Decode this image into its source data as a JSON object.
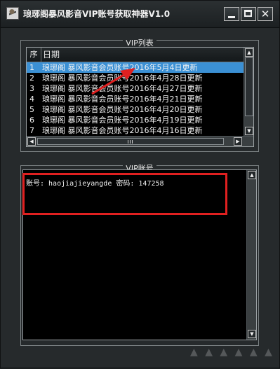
{
  "window": {
    "title": "琅琊阁暴风影音VIP账号获取神器V1.0",
    "controls": {
      "minimize": "minimize",
      "maximize": "maximize",
      "close": "✕"
    }
  },
  "vip_list": {
    "caption": "VIP列表",
    "columns": {
      "seq": "序",
      "date": "日期"
    },
    "rows": [
      {
        "seq": "1",
        "text": "琅琊阁 暴风影音会员账号2016年5月4日更新",
        "selected": true
      },
      {
        "seq": "2",
        "text": "琅琊阁 暴风影音会员账号2016年4月28日更新"
      },
      {
        "seq": "3",
        "text": "琅琊阁 暴风影音会员账号2016年4月27日更新"
      },
      {
        "seq": "4",
        "text": "琅琊阁 暴风影音会员账号2016年4月21日更新"
      },
      {
        "seq": "5",
        "text": "琅琊阁 暴风影音会员账号2016年4月20日更新"
      },
      {
        "seq": "6",
        "text": "琅琊阁 暴风影音会员账号2016年4月19日更新"
      },
      {
        "seq": "7",
        "text": "琅琊阁 暴风影音会员账号2016年4月16日更新"
      }
    ]
  },
  "vip_account": {
    "caption": "VIP账号",
    "content": "账号: haojiajieyangde 密码: 147258"
  },
  "colors": {
    "selection": "#3b90d4",
    "highlight": "#e02020",
    "background": "#262a2c"
  }
}
